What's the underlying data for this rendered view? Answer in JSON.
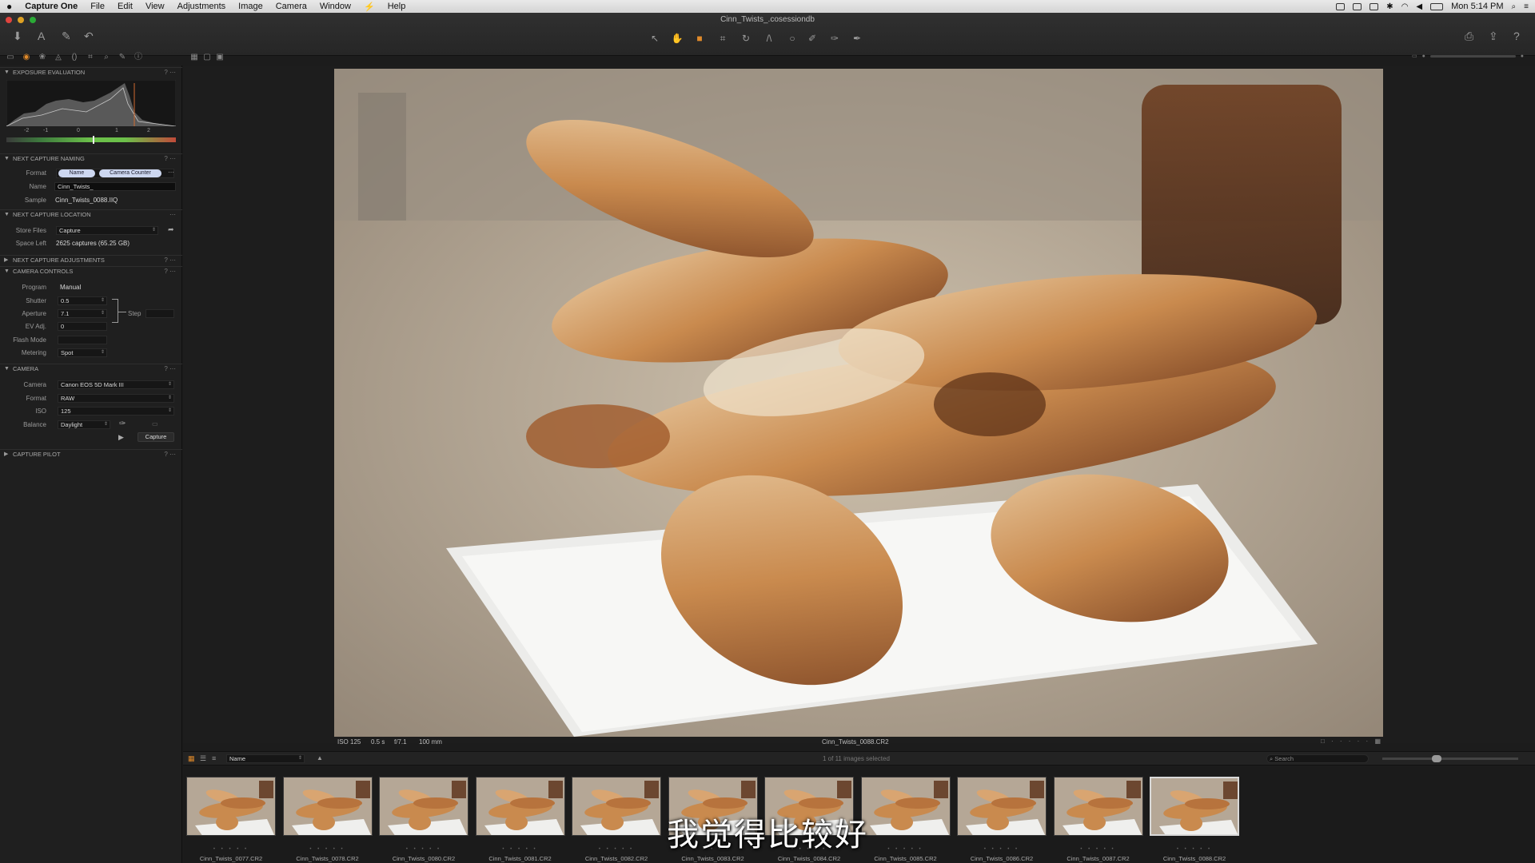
{
  "menubar": {
    "app_name": "Capture One",
    "items": [
      "File",
      "Edit",
      "View",
      "Adjustments",
      "Image",
      "Camera",
      "Window",
      "⚡",
      "Help"
    ],
    "clock": "Mon 5:14 PM"
  },
  "window": {
    "title": "Cinn_Twists_.cosessiondb"
  },
  "panels": {
    "exposure_evaluation": {
      "title": "EXPOSURE EVALUATION",
      "scale": [
        "-2",
        "-1",
        "0",
        "1",
        "2"
      ]
    },
    "next_capture_naming": {
      "title": "NEXT CAPTURE NAMING",
      "format_label": "Format",
      "format_tokens": [
        "Name",
        "Camera Counter"
      ],
      "name_label": "Name",
      "name_value": "Cinn_Twists_",
      "sample_label": "Sample",
      "sample_value": "Cinn_Twists_0088.IIQ"
    },
    "next_capture_location": {
      "title": "NEXT CAPTURE LOCATION",
      "store_label": "Store Files",
      "store_value": "Capture",
      "space_label": "Space Left",
      "space_value": "2625 captures (65.25 GB)"
    },
    "next_capture_adjustments": {
      "title": "NEXT CAPTURE ADJUSTMENTS"
    },
    "camera_controls": {
      "title": "CAMERA CONTROLS",
      "program_label": "Program",
      "program_value": "Manual",
      "shutter_label": "Shutter",
      "shutter_value": "0.5",
      "aperture_label": "Aperture",
      "aperture_value": "7.1",
      "step_label": "Step",
      "ev_label": "EV Adj.",
      "ev_value": "0",
      "flash_label": "Flash Mode",
      "metering_label": "Metering",
      "metering_value": "Spot"
    },
    "camera": {
      "title": "CAMERA",
      "camera_label": "Camera",
      "camera_value": "Canon EOS 5D Mark III",
      "format_label": "Format",
      "format_value": "RAW",
      "iso_label": "ISO",
      "iso_value": "125",
      "balance_label": "Balance",
      "balance_value": "Daylight",
      "capture_button": "Capture"
    },
    "capture_pilot": {
      "title": "CAPTURE PILOT"
    }
  },
  "viewer": {
    "info_iso": "ISO 125",
    "info_shutter": "0.5 s",
    "info_aperture": "f/7.1",
    "info_focal": "100 mm",
    "filename": "Cinn_Twists_0088.CR2"
  },
  "browser": {
    "sort_value": "Name",
    "selection_text": "1 of 11 images selected",
    "search_placeholder": "Search"
  },
  "filmstrip": {
    "thumbnails": [
      "Cinn_Twists_0077.CR2",
      "Cinn_Twists_0078.CR2",
      "Cinn_Twists_0080.CR2",
      "Cinn_Twists_0081.CR2",
      "Cinn_Twists_0082.CR2",
      "Cinn_Twists_0083.CR2",
      "Cinn_Twists_0084.CR2",
      "Cinn_Twists_0085.CR2",
      "Cinn_Twists_0086.CR2",
      "Cinn_Twists_0087.CR2",
      "Cinn_Twists_0088.CR2"
    ],
    "selected_index": 10
  },
  "subtitle": "我觉得比较好",
  "colors": {
    "accent": "#e08a2a",
    "panel_bg": "#1f1f1f",
    "app_bg": "#1c1c1c"
  },
  "icons": [
    "apple-icon",
    "import-icon",
    "text-icon",
    "brush-icon",
    "undo-icon",
    "select-icon",
    "pan-icon",
    "loupe-icon",
    "crop-icon",
    "rotate-icon",
    "keystone-icon",
    "spot-icon",
    "mask-brush-icon",
    "picker-icon",
    "print-icon",
    "export-icon",
    "help-icon",
    "search-icon"
  ]
}
